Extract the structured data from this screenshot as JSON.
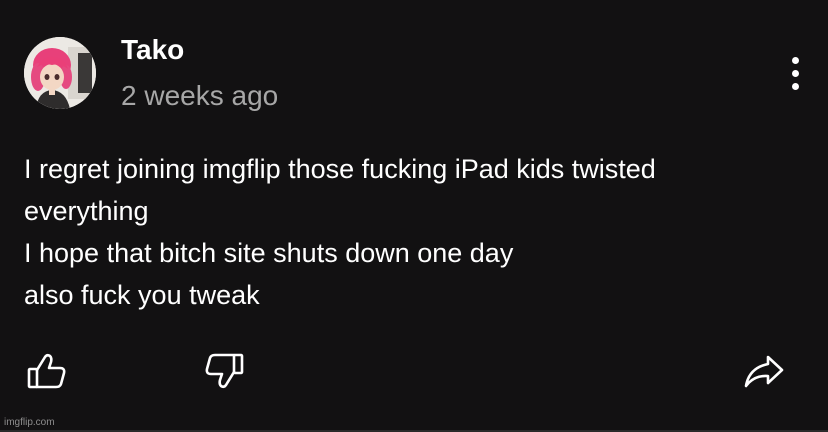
{
  "post": {
    "author": "Tako",
    "timestamp": "2 weeks ago",
    "body_lines": [
      "I regret joining imgflip those fucking iPad kids twisted",
      "everything",
      "I hope that bitch site shuts down one day",
      "also fuck you tweak"
    ]
  },
  "actions": {
    "like_icon": "thumbs-up-icon",
    "dislike_icon": "thumbs-down-icon",
    "share_icon": "share-icon",
    "more_icon": "more-vertical-icon"
  },
  "watermark": "imgflip.com",
  "colors": {
    "background": "#121112",
    "text": "#ffffff",
    "secondary_text": "#a7a7a7",
    "avatar_hair": "#e8407a"
  }
}
